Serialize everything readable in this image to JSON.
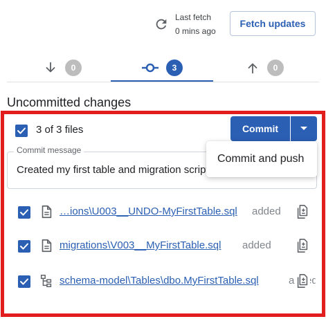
{
  "header": {
    "last_fetch_label": "Last fetch",
    "last_fetch_time": "0 mins ago",
    "fetch_button": "Fetch updates"
  },
  "tabs": [
    {
      "icon": "arrow-down-icon",
      "count": "0",
      "active": false
    },
    {
      "icon": "commit-icon",
      "count": "3",
      "active": true
    },
    {
      "icon": "arrow-up-icon",
      "count": "0",
      "active": false
    }
  ],
  "section_title": "Uncommitted changes",
  "commit_panel": {
    "files_count": "3 of 3 files",
    "commit_button": "Commit",
    "message_label": "Commit message",
    "message_value": "Created my first table and migration scripts",
    "popup_item": "Commit and push"
  },
  "files": [
    {
      "path": "…ions\\U003__UNDO-MyFirstTable.sql",
      "status": "added",
      "icon": "file-icon"
    },
    {
      "path": "migrations\\V003__MyFirstTable.sql",
      "status": "added",
      "icon": "file-icon"
    },
    {
      "path": "schema-model\\Tables\\dbo.MyFirstTable.sql",
      "status": "added",
      "icon": "schema-tree-icon"
    }
  ],
  "colors": {
    "accent": "#2b5fb3",
    "highlight_frame": "#e11d1d",
    "badge_inactive": "#bdbdbd"
  }
}
